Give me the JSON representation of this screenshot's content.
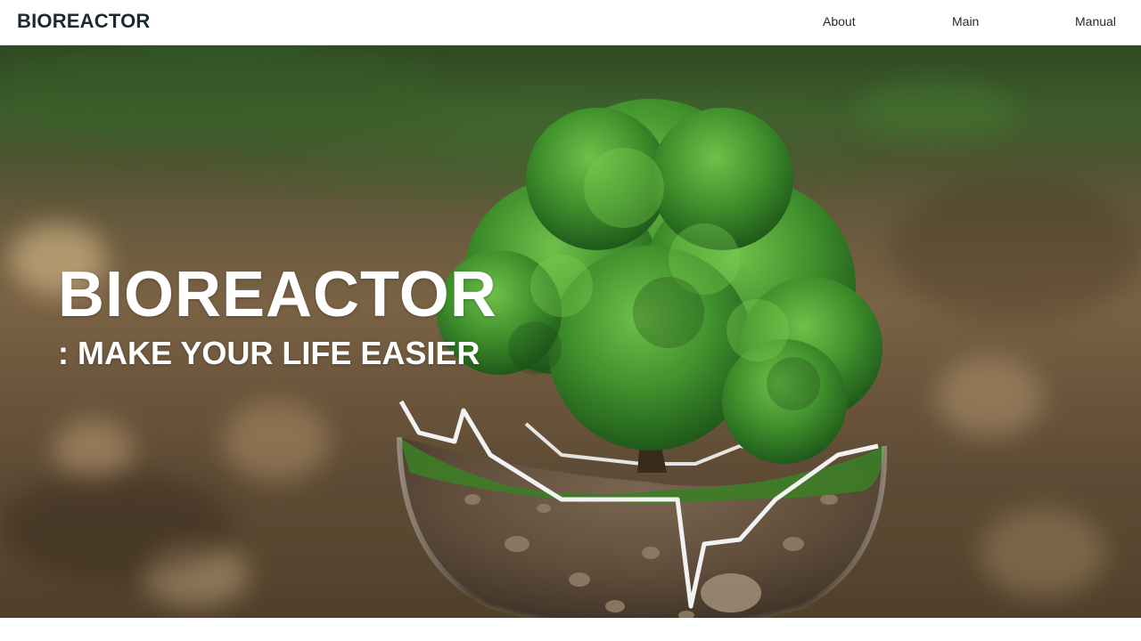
{
  "header": {
    "brand": "BIOREACTOR",
    "nav": [
      {
        "label": "About"
      },
      {
        "label": "Main"
      },
      {
        "label": "Manual"
      }
    ]
  },
  "hero": {
    "headline": "BIOREACTOR",
    "subheadline": ": MAKE YOUR LIFE EASIER",
    "image_subject": "tree-in-glass-globe-icon"
  },
  "colors": {
    "header_bg": "#ffffff",
    "brand_text": "#1f2a30",
    "hero_text": "#ffffff",
    "foliage": "#3f8a2c",
    "soil": "#6b5842"
  }
}
